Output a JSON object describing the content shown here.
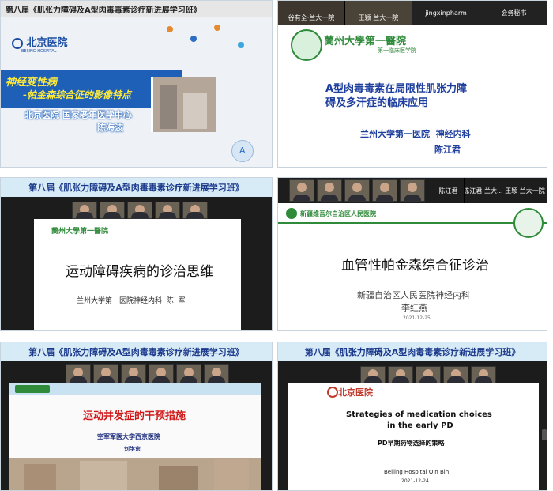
{
  "panel1": {
    "title_bar": "第八届《肌张力障碍及A型肉毒毒素诊疗新进展学习班》",
    "logo": "北京医院",
    "logo_en": "BEIJING HOSPITAL",
    "blue_title_1": "神经变性病",
    "blue_title_2": "-帕金森综合征的影像特点",
    "subtitle": "北京医院 国家老年医学中心",
    "speaker": "陈海波"
  },
  "panel2": {
    "participants": [
      "谷有全·兰大一院",
      "王颖 兰大一院",
      "jingxinpharm",
      "会务秘书"
    ],
    "hospital_logo": "蘭州大學第一醫院",
    "hospital_logo_sub": "第一临床医学院",
    "title_line1": "A型肉毒毒素在局限性肌张力障",
    "title_line2": "碍及多汗症的临床应用",
    "affiliation": "兰州大学第一医院  神经内科",
    "speaker": "陈江君"
  },
  "panel3": {
    "title_bar": "第八届《肌张力障碍及A型肉毒毒素诊疗新进展学习班》",
    "logo": "蘭州大學第一醫院",
    "title": "运动障碍疾病的诊治思维",
    "affiliation": "兰州大学第一医院神经内科  陈  军"
  },
  "panel4": {
    "participants": [
      "陈江君",
      "陈江君 兰大...",
      "王颖 兰大一院"
    ],
    "hospital": "新疆维吾尔自治区人民医院",
    "title": "血管性帕金森综合征诊治",
    "affiliation": "新疆自治区人民医院神经内科",
    "speaker": "李红燕",
    "date": "2021-12-25"
  },
  "panel5": {
    "title_bar": "第八届《肌张力障碍及A型肉毒毒素诊疗新进展学习班》",
    "title": "运动并发症的干预措施",
    "affiliation": "空军军医大学西京医院",
    "speaker": "刘学东"
  },
  "panel6": {
    "title_bar": "第八届《肌张力障碍及A型肉毒毒素诊疗新进展学习班》",
    "logo": "北京医院",
    "title_line1": "Strategies of medication choices",
    "title_line2": "in the early PD",
    "subtitle": "PD早期药物选择的策略",
    "affiliation": "Beijing Hospital Qin Bin",
    "date": "2021-12-24"
  }
}
